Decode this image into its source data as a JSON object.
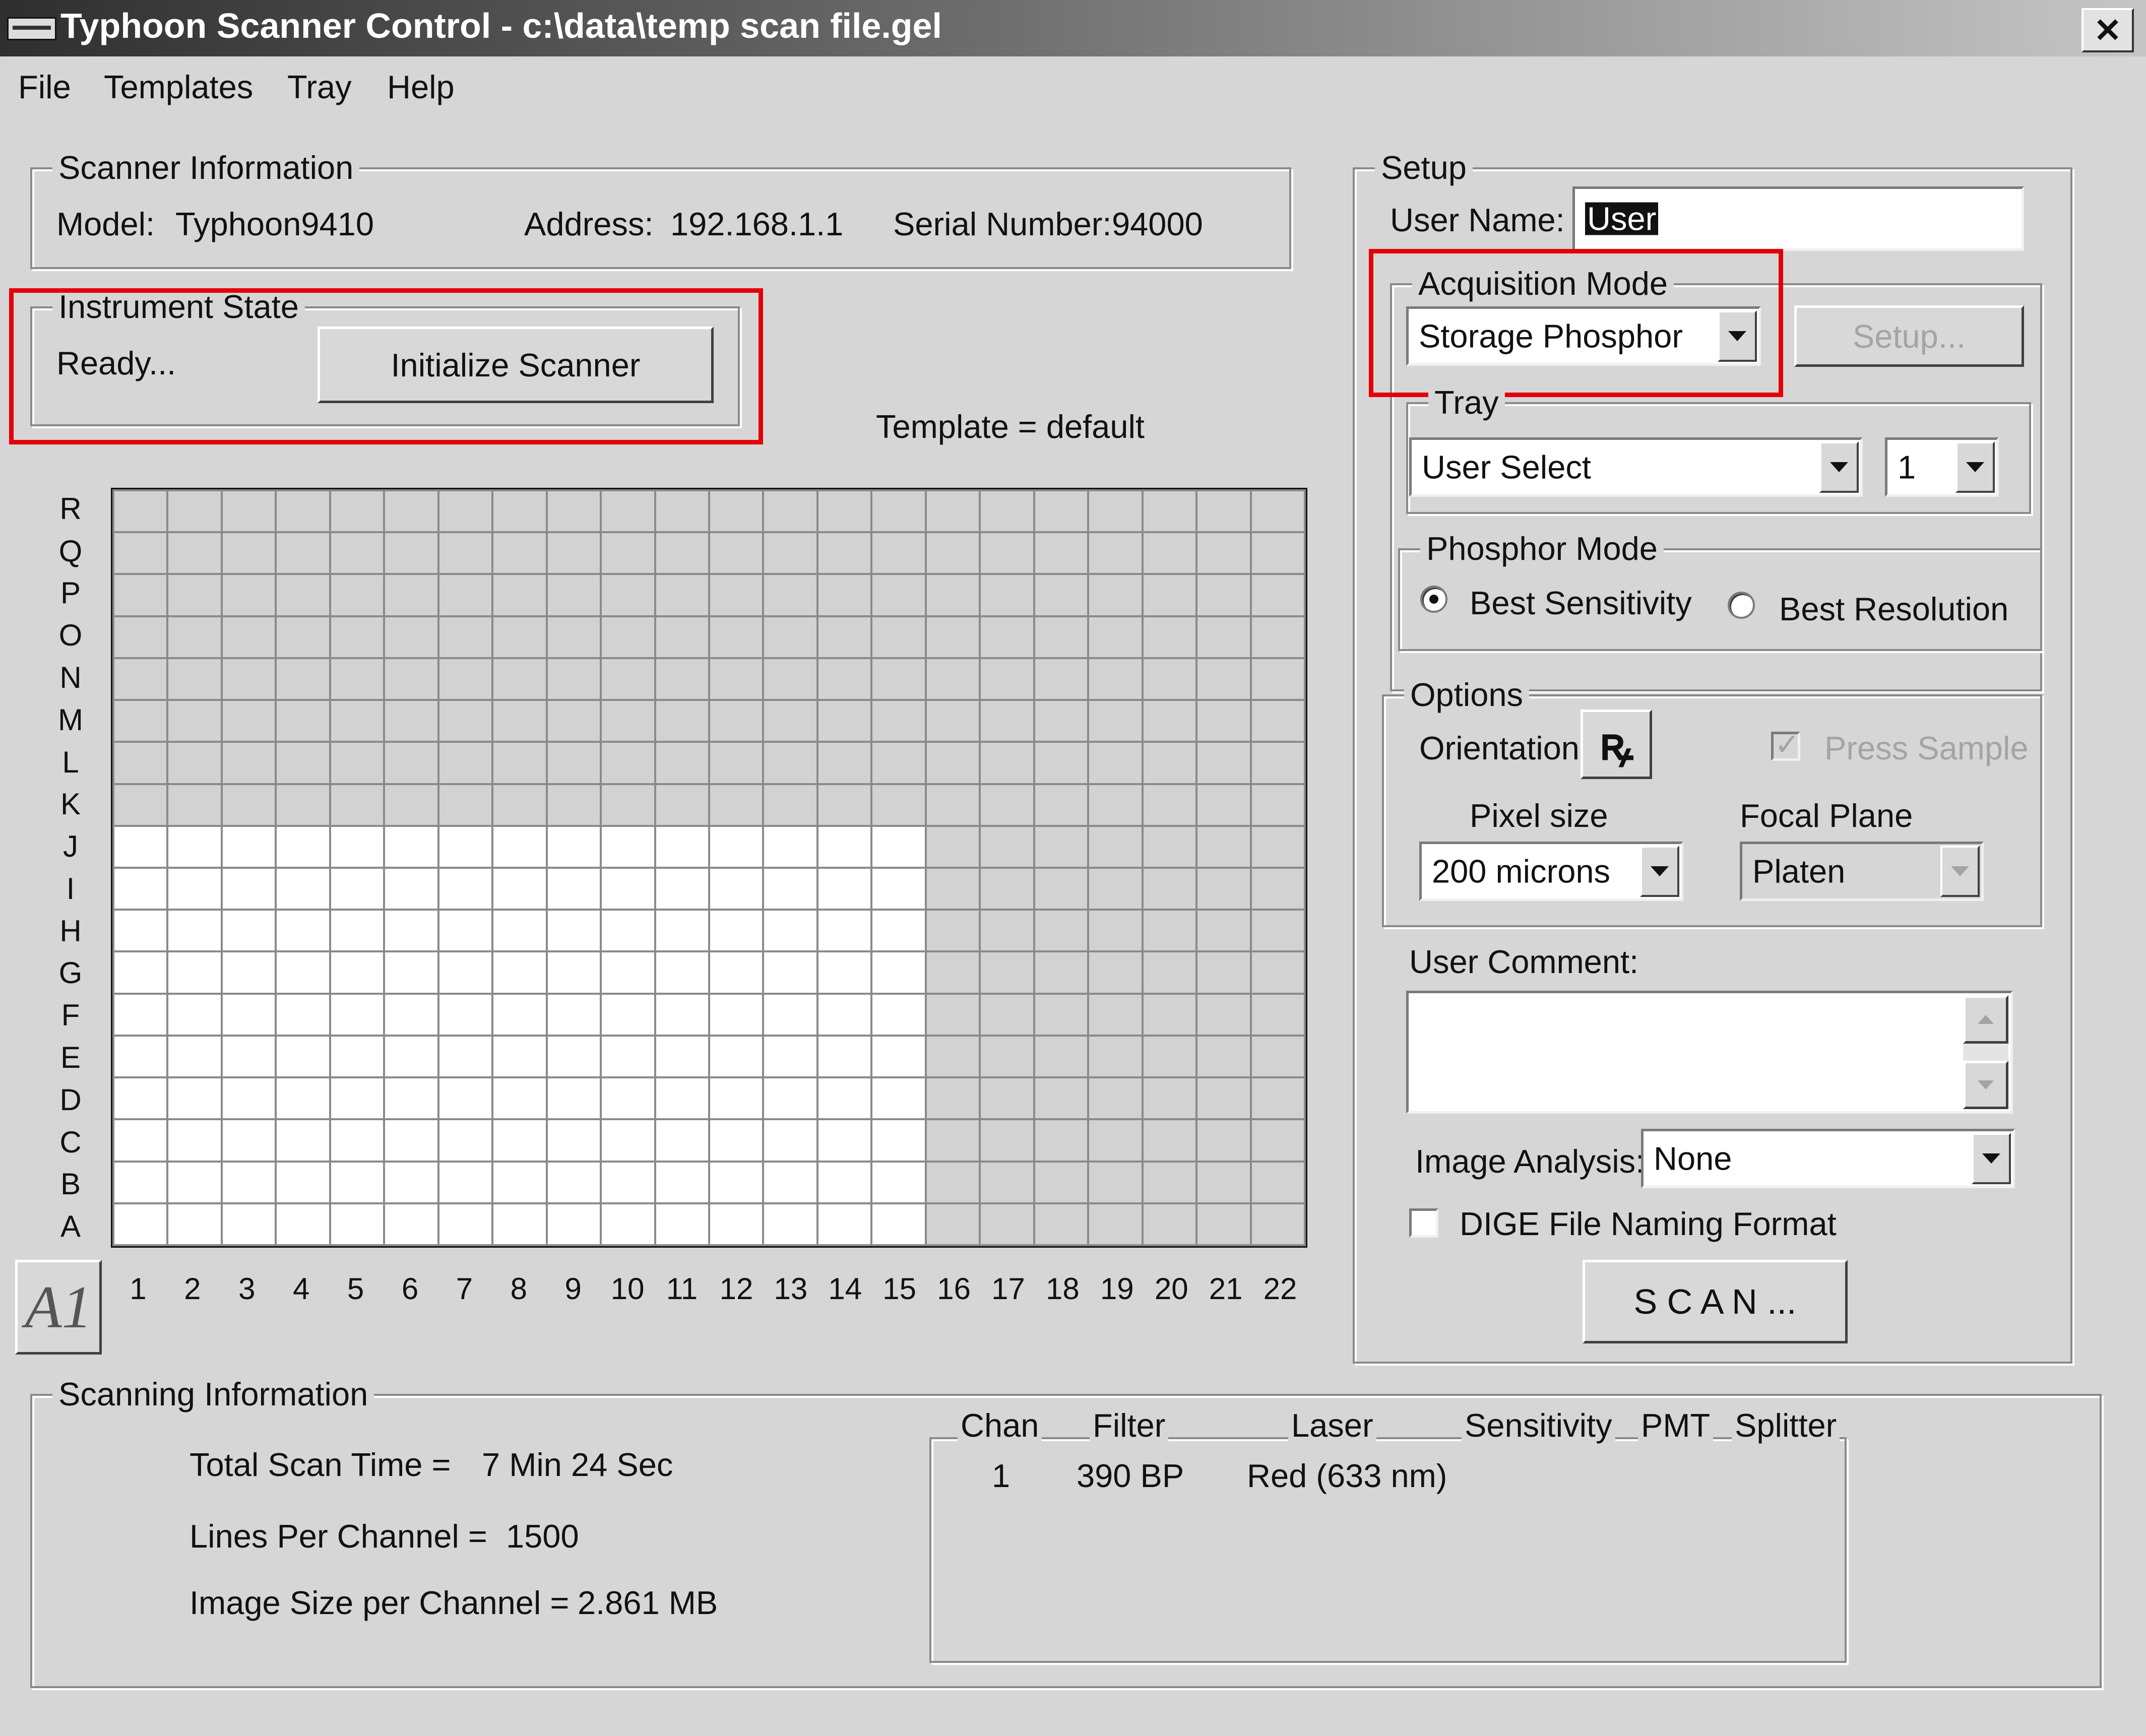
{
  "window": {
    "title": "Typhoon Scanner Control - c:\\data\\temp scan file.gel",
    "close": "✕"
  },
  "menu": [
    "File",
    "Templates",
    "Tray",
    "Help"
  ],
  "scanner_info": {
    "title": "Scanner Information",
    "model_label": "Model:",
    "model": "Typhoon9410",
    "address_label": "Address:",
    "address": "192.168.1.1",
    "serial_label": "Serial Number:",
    "serial": "94000"
  },
  "instrument_state": {
    "title": "Instrument State",
    "status": "Ready...",
    "button": "Initialize Scanner"
  },
  "template_label": "Template = default",
  "grid": {
    "rows": [
      "R",
      "Q",
      "P",
      "O",
      "N",
      "M",
      "L",
      "K",
      "J",
      "I",
      "H",
      "G",
      "F",
      "E",
      "D",
      "C",
      "B",
      "A"
    ],
    "cols": [
      "1",
      "2",
      "3",
      "4",
      "5",
      "6",
      "7",
      "8",
      "9",
      "10",
      "11",
      "12",
      "13",
      "14",
      "15",
      "16",
      "17",
      "18",
      "19",
      "20",
      "21",
      "22"
    ],
    "selected_rows": [
      "J",
      "I",
      "H",
      "G",
      "F",
      "E",
      "D",
      "C",
      "B",
      "A"
    ],
    "selected_col_count": 15,
    "corner_button": "A1"
  },
  "setup": {
    "title": "Setup",
    "user_name_label": "User Name:",
    "user_name": "User",
    "acquisition_title": "Acquisition Mode",
    "acquisition_value": "Storage Phosphor",
    "setup_button": "Setup...",
    "tray_title": "Tray",
    "tray_value": "User Select",
    "tray_number": "1",
    "phosphor_title": "Phosphor Mode",
    "best_sensitivity": "Best Sensitivity",
    "best_resolution": "Best Resolution",
    "options_title": "Options",
    "orientation_label": "Orientation",
    "orientation_icon": "ꝶ",
    "press_sample": "Press Sample",
    "pixel_size_label": "Pixel size",
    "pixel_size_value": "200 microns",
    "focal_plane_label": "Focal Plane",
    "focal_plane_value": "Platen",
    "user_comment_label": "User Comment:",
    "user_comment": "",
    "image_analysis_label": "Image Analysis:",
    "image_analysis_value": "None",
    "dige_label": "DIGE File Naming Format",
    "scan_button": "S C A N ..."
  },
  "scanning_info": {
    "title": "Scanning Information",
    "total_time_label": "Total Scan Time =",
    "total_time": "7 Min 24 Sec",
    "lines_label": "Lines Per Channel =",
    "lines": "1500",
    "image_size_label": "Image Size per Channel =",
    "image_size": "2.861 MB",
    "columns": [
      "Chan",
      "Filter",
      "Laser",
      "Sensitivity",
      "PMT",
      "Splitter"
    ],
    "rows": [
      {
        "chan": "1",
        "filter": "390 BP",
        "laser": "Red (633 nm)"
      }
    ]
  },
  "colors": {
    "highlight_box": "#e3000b",
    "window_bg": "#d6d6d6",
    "selected_cell": "#ffffff",
    "unselected_cell": "#d2d2d2"
  }
}
